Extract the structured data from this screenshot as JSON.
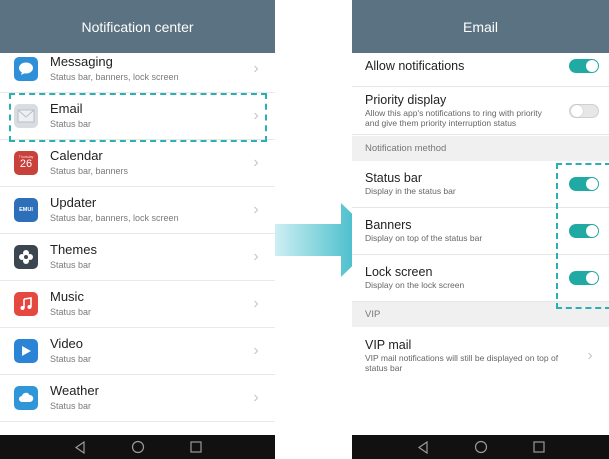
{
  "left": {
    "title": "Notification center",
    "apps": [
      {
        "name": "Messaging",
        "sub": "Status bar, banners, lock screen",
        "icon": "messaging-icon",
        "color": "#2f8fd8"
      },
      {
        "name": "Email",
        "sub": "Status bar",
        "icon": "email-icon",
        "color": "#d9dde2"
      },
      {
        "name": "Calendar",
        "sub": "Status bar, banners",
        "icon": "calendar-icon",
        "color": "#c8413b",
        "icon_text": "26",
        "icon_sub": "Thursday"
      },
      {
        "name": "Updater",
        "sub": "Status bar, banners, lock screen",
        "icon": "updater-icon",
        "color": "#2d6fb8",
        "icon_text": "EMUI"
      },
      {
        "name": "Themes",
        "sub": "Status bar",
        "icon": "themes-icon",
        "color": "#3c4650"
      },
      {
        "name": "Music",
        "sub": "Status bar",
        "icon": "music-icon",
        "color": "#e5483f"
      },
      {
        "name": "Video",
        "sub": "Status bar",
        "icon": "video-icon",
        "color": "#2b84d6"
      },
      {
        "name": "Weather",
        "sub": "Status bar",
        "icon": "weather-icon",
        "color": "#2f97d8"
      }
    ]
  },
  "right": {
    "title": "Email",
    "allow": {
      "title": "Allow notifications",
      "on": true
    },
    "priority": {
      "title": "Priority display",
      "sub": "Allow this app's notifications to ring with priority and give them priority interruption status",
      "on": false
    },
    "section_method": "Notification method",
    "status_bar": {
      "title": "Status bar",
      "sub": "Display in the status bar",
      "on": true
    },
    "banners": {
      "title": "Banners",
      "sub": "Display on top of the status bar",
      "on": true
    },
    "lock_screen": {
      "title": "Lock screen",
      "sub": "Display on the lock screen",
      "on": true
    },
    "section_vip": "VIP",
    "vip_mail": {
      "title": "VIP mail",
      "sub": "VIP mail notifications will still be displayed on top of status bar"
    }
  },
  "colors": {
    "titlebar": "#5a7281",
    "accent": "#21a9a3",
    "highlight_dash": "#2ab0b2",
    "arrow": "#2fb6c4"
  }
}
